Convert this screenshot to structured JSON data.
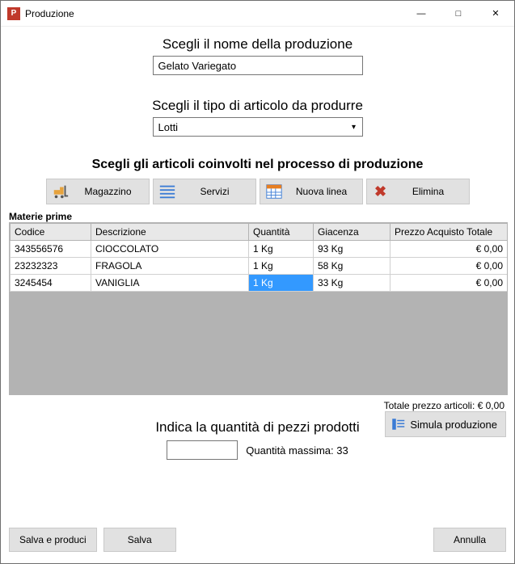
{
  "window": {
    "title": "Produzione"
  },
  "section1": {
    "label": "Scegli il nome della produzione",
    "value": "Gelato Variegato"
  },
  "section2": {
    "label": "Scegli il tipo di articolo da produrre",
    "value": "Lotti"
  },
  "section3": {
    "label": "Scegli gli articoli coinvolti nel processo di produzione",
    "toolbar": {
      "magazzino": "Magazzino",
      "servizi": "Servizi",
      "nuovalinea": "Nuova linea",
      "elimina": "Elimina"
    }
  },
  "grid": {
    "title": "Materie prime",
    "headers": {
      "codice": "Codice",
      "descrizione": "Descrizione",
      "quantita": "Quantità",
      "giacenza": "Giacenza",
      "prezzo": "Prezzo Acquisto Totale"
    },
    "rows": [
      {
        "codice": "343556576",
        "descrizione": "CIOCCOLATO",
        "quantita": "1 Kg",
        "giacenza": "93 Kg",
        "prezzo": "€ 0,00"
      },
      {
        "codice": "23232323",
        "descrizione": "FRAGOLA",
        "quantita": "1 Kg",
        "giacenza": "58 Kg",
        "prezzo": "€ 0,00"
      },
      {
        "codice": "3245454",
        "descrizione": "VANIGLIA",
        "quantita": "1 Kg",
        "giacenza": "33 Kg",
        "prezzo": "€ 0,00"
      }
    ],
    "selected_row": 2,
    "selected_col": "quantita"
  },
  "total": {
    "label": "Totale prezzo articoli: € 0,00"
  },
  "qty": {
    "label": "Indica la quantità di pezzi prodotti",
    "value": "",
    "max_label": "Quantità massima: 33",
    "simula": "Simula produzione"
  },
  "footer": {
    "salva_produci": "Salva e produci",
    "salva": "Salva",
    "annulla": "Annulla"
  }
}
